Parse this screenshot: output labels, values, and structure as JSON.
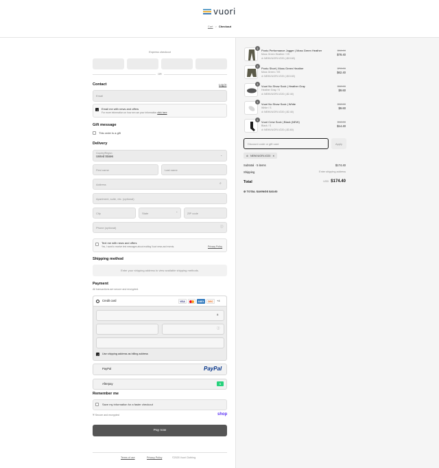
{
  "brand": {
    "name": "vuori"
  },
  "breadcrumb": {
    "cart": "Cart",
    "separator": ">",
    "current": "Checkout"
  },
  "express": {
    "title": "Express checkout",
    "or": "OR"
  },
  "contact": {
    "title": "Contact",
    "login": "Log in",
    "email_placeholder": "Email",
    "newsletter_label": "Email me with news and offers",
    "privacy_note": "For more information on how we use your information",
    "privacy_link": "click here"
  },
  "gift": {
    "title": "Gift message",
    "label": "This order is a gift"
  },
  "delivery": {
    "title": "Delivery",
    "country_label": "Country/Region",
    "country_value": "United States",
    "first_name": "First name",
    "last_name": "Last name",
    "address": "Address",
    "apartment": "Apartment, suite, etc. (optional)",
    "city": "City",
    "state": "State",
    "zip": "ZIP code",
    "phone": "Phone (optional)",
    "text_title": "Text me with news and offers",
    "text_note": "Yes, I want to receive text messages about exciting Vuori news and events.",
    "text_link": "Privacy Policy"
  },
  "shipping": {
    "title": "Shipping method",
    "placeholder": "Enter your shipping address to view available shipping methods."
  },
  "payment": {
    "title": "Payment",
    "subtitle": "All transactions are secure and encrypted.",
    "credit_card": "Credit card",
    "more_cards": "+4",
    "billing_label": "Use shipping address as billing address",
    "paypal": "PayPal",
    "paypal_logo": "PayPal",
    "afterpay": "Afterpay",
    "card_brands": [
      "VISA",
      "MC",
      "AMEX",
      "DISC"
    ]
  },
  "remember": {
    "title": "Remember me",
    "label": "Save my information for a faster checkout",
    "secure": "Secure and encrypted",
    "shop": "shop"
  },
  "pay_now": "Pay now",
  "footer": {
    "terms": "Terms of use",
    "privacy": "Privacy Policy",
    "copyright": "©2025 Vuori Clothing"
  },
  "cart": {
    "items": [
      {
        "title": "Ponto Performance Jogger | Moss Green Heather",
        "variant": "Moss Green Heather / XS",
        "discount": "NEWVUORI-V220 (-$19.60)",
        "original": "$98.00",
        "price": "$78.40",
        "qty": "1",
        "thumb": "pants"
      },
      {
        "title": "Ponto Short | Moss Green Heather",
        "variant": "Moss Green / XS",
        "discount": "NEWVUORI-V220 (-$15.60)",
        "original": "$78.00",
        "price": "$62.40",
        "qty": "1",
        "thumb": "shorts"
      },
      {
        "title": "Vuori No Show Sock | Heather Gray",
        "variant": "Heather Gray / S",
        "discount": "NEWVUORI-V220 (-$2.40)",
        "original": "$12.00",
        "price": "$9.60",
        "qty": "1",
        "thumb": "sock-gray"
      },
      {
        "title": "Vuori No Show Sock | White",
        "variant": "White / S",
        "discount": "NEWVUORI-V220 (-$2.40)",
        "original": "$12.00",
        "price": "$9.60",
        "qty": "1",
        "thumb": "sock-white"
      },
      {
        "title": "Vuori Crew Sock | Black (NEW)",
        "variant": "Black / S",
        "discount": "NEWVUORI-V220 (-$3.60)",
        "original": "$18.00",
        "price": "$14.40",
        "qty": "1",
        "thumb": "sock-black"
      }
    ],
    "discount_placeholder": "Discount code or gift card",
    "apply": "Apply",
    "applied_code": "NEWVUORI-V220",
    "subtotal_label": "Subtotal · 5 items",
    "subtotal": "$174.40",
    "shipping_label": "Shipping",
    "shipping_value": "Enter shipping address",
    "total_label": "Total",
    "currency": "USD",
    "total": "$174.40",
    "savings": "TOTAL SAVINGS  $43.60"
  },
  "colors": {
    "accent": "#1a1a1a",
    "pay_button": "#555555",
    "paypal_blue": "#003087",
    "afterpay_green": "#27d17c"
  }
}
